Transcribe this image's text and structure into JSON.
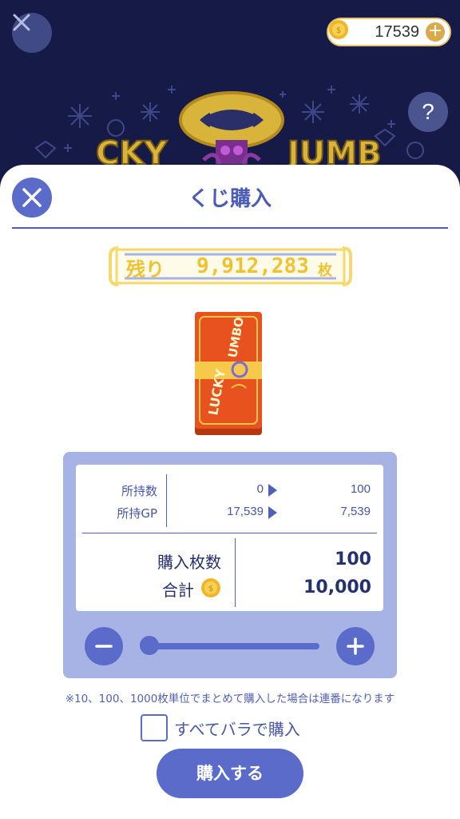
{
  "header": {
    "coin_balance": "17539",
    "help_label": "?",
    "add_label": "+"
  },
  "sheet": {
    "title": "くじ購入",
    "remaining_label": "残り",
    "remaining_value": "9,912,283",
    "remaining_unit": "枚"
  },
  "ticket": {
    "label_top": "UMBO",
    "label_bottom": "LUCKY"
  },
  "summary": {
    "owned_label": "所持数",
    "owned_from": "0",
    "owned_to": "100",
    "gp_label": "所持GP",
    "gp_from": "17,539",
    "gp_to": "7,539",
    "quantity_label": "購入枚数",
    "quantity_value": "100",
    "total_label": "合計",
    "total_value": "10,000"
  },
  "slider": {
    "level_fraction": 0.03
  },
  "note": "※10、100、1000枚単位でまとめて購入した場合は連番になります",
  "bulk_option": {
    "label": "すべてバラで購入",
    "checked": false
  },
  "buy_button_label": "購入する",
  "colors": {
    "primary": "#5a6bc9",
    "panel": "#a7b3e4",
    "gold": "#f0c231",
    "background": "#161a46",
    "ticket": "#e8521e"
  }
}
